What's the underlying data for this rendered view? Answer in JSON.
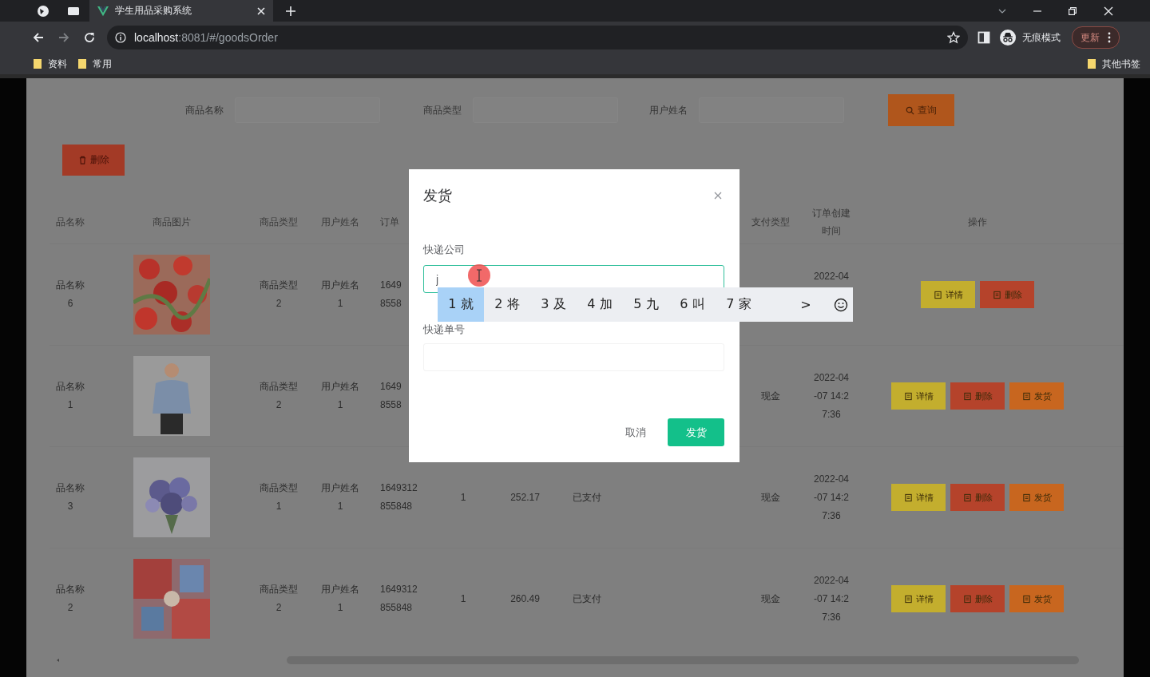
{
  "browser": {
    "tab_title": "学生用品采购系统",
    "address": {
      "host": "localhost",
      "path": ":8081/#/goodsOrder"
    },
    "profile_label": "无痕模式",
    "update_button": "更新",
    "bookmarks": [
      "资料",
      "常用"
    ],
    "other_bookmarks": "其他书签"
  },
  "search": {
    "fields": [
      {
        "label": "商品名称"
      },
      {
        "label": "商品类型"
      },
      {
        "label": "用户姓名"
      }
    ],
    "query_button": "查询"
  },
  "delete_button": "删除",
  "table": {
    "headers": {
      "name": "品名称",
      "image": "商品图片",
      "type": "商品类型",
      "user": "用户姓名",
      "order": "订单",
      "pay": "支付类型",
      "time": [
        "订单创建",
        "时间"
      ],
      "ops": "操作"
    },
    "rows": [
      {
        "image": {
          "kind": "picture"
        },
        "cells": {
          "name": [
            "品名称",
            "6"
          ],
          "type": [
            "商品类型",
            "2"
          ],
          "user": [
            "用户姓名",
            "1"
          ],
          "order": [
            "1649",
            "8558"
          ],
          "time": [
            "2022-04"
          ]
        },
        "actions": [
          {
            "kind": "detail",
            "label": "详情"
          },
          {
            "kind": "delete",
            "label": "删除"
          }
        ]
      },
      {
        "image": {
          "kind": "picture"
        },
        "cells": {
          "name": [
            "品名称",
            "1"
          ],
          "type": [
            "商品类型",
            "2"
          ],
          "user": [
            "用户姓名",
            "1"
          ],
          "order": [
            "1649",
            "8558"
          ],
          "pay": [
            "现金"
          ],
          "time": [
            "2022-04",
            "-07 14:2",
            "7:36"
          ]
        },
        "actions": [
          {
            "kind": "detail",
            "label": "详情"
          },
          {
            "kind": "delete",
            "label": "删除"
          },
          {
            "kind": "ship",
            "label": "发货"
          }
        ]
      },
      {
        "image": {
          "kind": "picture"
        },
        "cells": {
          "name": [
            "品名称",
            "3"
          ],
          "type": [
            "商品类型",
            "1"
          ],
          "user": [
            "用户姓名",
            "1"
          ],
          "order": [
            "1649312",
            "855848"
          ],
          "count": [
            "1"
          ],
          "price": [
            "252.17"
          ],
          "status": [
            "已支付"
          ],
          "pay": [
            "现金"
          ],
          "time": [
            "2022-04",
            "-07 14:2",
            "7:36"
          ]
        },
        "actions": [
          {
            "kind": "detail",
            "label": "详情"
          },
          {
            "kind": "delete",
            "label": "删除"
          },
          {
            "kind": "ship",
            "label": "发货"
          }
        ]
      },
      {
        "image": {
          "kind": "picture"
        },
        "cells": {
          "name": [
            "品名称",
            "2"
          ],
          "type": [
            "商品类型",
            "2"
          ],
          "user": [
            "用户姓名",
            "1"
          ],
          "order": [
            "1649312",
            "855848"
          ],
          "count": [
            "1"
          ],
          "price": [
            "260.49"
          ],
          "status": [
            "已支付"
          ],
          "pay": [
            "现金"
          ],
          "time": [
            "2022-04",
            "-07 14:2",
            "7:36"
          ]
        },
        "actions": [
          {
            "kind": "detail",
            "label": "详情"
          },
          {
            "kind": "delete",
            "label": "删除"
          },
          {
            "kind": "ship",
            "label": "发货"
          }
        ]
      }
    ]
  },
  "dialog": {
    "title": "发货",
    "fields": [
      {
        "label": "快递公司",
        "value": "j",
        "focused": true
      },
      {
        "label": "快递单号",
        "focused": false
      }
    ],
    "cancel_button": "取消",
    "confirm_button": "发货"
  },
  "ime": {
    "candidates": [
      {
        "text": "1 就",
        "selected": true
      },
      {
        "text": "2 将",
        "selected": false
      },
      {
        "text": "3 及",
        "selected": false
      },
      {
        "text": "4 加",
        "selected": false
      },
      {
        "text": "5 九",
        "selected": false
      },
      {
        "text": "6 叫",
        "selected": false
      },
      {
        "text": "7 家",
        "selected": false
      }
    ],
    "next": ">"
  }
}
